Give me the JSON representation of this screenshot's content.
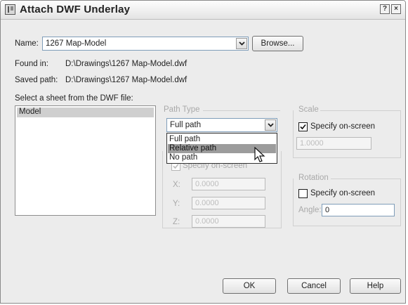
{
  "window": {
    "title": "Attach DWF Underlay",
    "help_button": "?",
    "close_button": "×"
  },
  "name": {
    "label": "Name:",
    "value": "1267 Map-Model",
    "browse_label": "Browse..."
  },
  "found_in": {
    "label": "Found in:",
    "value": "D:\\Drawings\\1267 Map-Model.dwf"
  },
  "saved_path": {
    "label": "Saved path:",
    "value": "D:\\Drawings\\1267 Map-Model.dwf"
  },
  "sheet": {
    "label": "Select a sheet from the DWF file:",
    "items": [
      "Model"
    ],
    "selected": "Model"
  },
  "path_type": {
    "label": "Path Type",
    "value": "Full path",
    "options": [
      "Full path",
      "Relative path",
      "No path"
    ],
    "highlighted": "Relative path"
  },
  "insertion_point": {
    "specify_label": "Specify on-screen",
    "x_label": "X:",
    "y_label": "Y:",
    "z_label": "Z:",
    "x_value": "0.0000",
    "y_value": "0.0000",
    "z_value": "0.0000"
  },
  "scale": {
    "label": "Scale",
    "specify_label": "Specify on-screen",
    "specify_checked": true,
    "value": "1.0000"
  },
  "rotation": {
    "label": "Rotation",
    "specify_label": "Specify on-screen",
    "specify_checked": false,
    "angle_label": "Angle:",
    "angle_value": "0"
  },
  "buttons": {
    "ok": "OK",
    "cancel": "Cancel",
    "help": "Help"
  }
}
